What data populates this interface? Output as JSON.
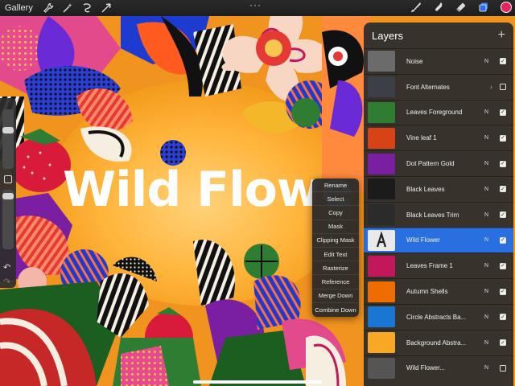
{
  "toolbar": {
    "gallery_label": "Gallery",
    "more_label": "···",
    "left_icons": [
      "wrench-icon",
      "magic-wand-icon",
      "selection-icon",
      "transform-arrow-icon"
    ],
    "right_icons": [
      "brush-icon",
      "smudge-icon",
      "eraser-icon",
      "layers-icon"
    ],
    "active_color": "#e8235f"
  },
  "canvas": {
    "title": "Wild Flowe"
  },
  "layers": {
    "title": "Layers",
    "add_label": "+",
    "items": [
      {
        "name": "Noise",
        "blend": "N",
        "visible": true,
        "selected": false,
        "thumb": "#6b6b6b"
      },
      {
        "name": "Font Alternates",
        "blend": "",
        "visible": false,
        "selected": false,
        "group": true,
        "thumb": "#3c3f45"
      },
      {
        "name": "Leaves Foreground",
        "blend": "N",
        "visible": true,
        "selected": false,
        "thumb": "#2e7d32"
      },
      {
        "name": "Vine leaf 1",
        "blend": "N",
        "visible": true,
        "selected": false,
        "thumb": "#d84315"
      },
      {
        "name": "Dot Pattern Gold",
        "blend": "N",
        "visible": true,
        "selected": false,
        "thumb": "#7b1fa2"
      },
      {
        "name": "Black Leaves",
        "blend": "N",
        "visible": true,
        "selected": false,
        "thumb": "#1b1b1b"
      },
      {
        "name": "Black Leaves Trim",
        "blend": "N",
        "visible": true,
        "selected": false,
        "thumb": "#2b2b2b"
      },
      {
        "name": "Wild Flower",
        "blend": "N",
        "visible": true,
        "selected": true,
        "thumb": "#3a4a6a"
      },
      {
        "name": "Leaves Frame 1",
        "blend": "N",
        "visible": true,
        "selected": false,
        "thumb": "#c2185b"
      },
      {
        "name": "Autumn Shells",
        "blend": "N",
        "visible": true,
        "selected": false,
        "thumb": "#ef6c00"
      },
      {
        "name": "Circle Abstracts Ba...",
        "blend": "N",
        "visible": true,
        "selected": false,
        "thumb": "#1976d2"
      },
      {
        "name": "Background Abstra...",
        "blend": "N",
        "visible": true,
        "selected": false,
        "thumb": "#f9a825"
      },
      {
        "name": "Wild Flower...",
        "blend": "N",
        "visible": false,
        "selected": false,
        "thumb": "#555555"
      }
    ]
  },
  "context_menu": {
    "items": [
      "Rename",
      "Select",
      "Copy",
      "Mask",
      "Clipping Mask",
      "Edit Text",
      "Rasterize",
      "Reference",
      "Merge Down",
      "Combine Down"
    ]
  }
}
